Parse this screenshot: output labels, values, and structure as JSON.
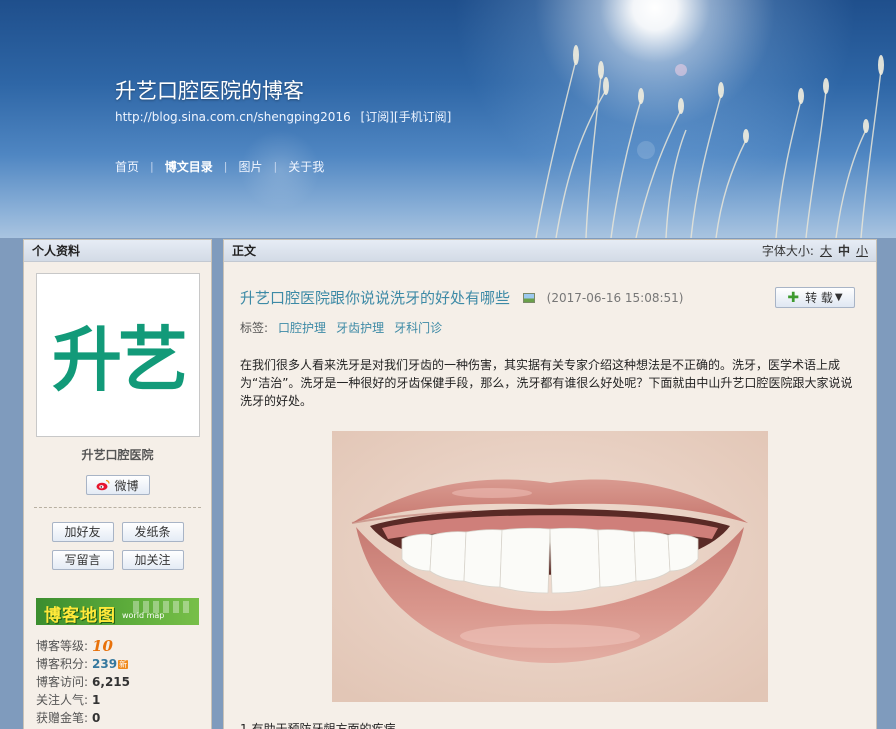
{
  "header": {
    "blog_title": "升艺口腔医院的博客",
    "blog_url": "http://blog.sina.com.cn/shengping2016",
    "subscribe": "[订阅]",
    "mobile_subscribe": "[手机订阅]",
    "nav": [
      "首页",
      "博文目录",
      "图片",
      "关于我"
    ],
    "nav_active": "博文目录"
  },
  "sidebar": {
    "title": "个人资料",
    "avatar_text": "升艺",
    "owner_name": "升艺口腔医院",
    "weibo_label": "微博",
    "buttons": [
      "加好友",
      "发纸条",
      "写留言",
      "加关注"
    ],
    "map_banner": "博客地图",
    "map_sub": "world map",
    "stats": [
      {
        "label": "博客等级:",
        "value": "10"
      },
      {
        "label": "博客积分:",
        "value": "239"
      },
      {
        "label": "博客访问:",
        "value": "6,215"
      },
      {
        "label": "关注人气:",
        "value": "1"
      },
      {
        "label": "获赠金笔:",
        "value": "0"
      }
    ],
    "new_badge": "新"
  },
  "main": {
    "section_label": "正文",
    "font_size_label": "字体大小:",
    "font_sizes": [
      "大",
      "中",
      "小"
    ],
    "font_size_current": "中",
    "post_title": "升艺口腔医院跟你说说洗牙的好处有哪些",
    "post_date": "(2017-06-16 15:08:51)",
    "repost_label": "转 载",
    "tags_label": "标签:",
    "tags": [
      "口腔护理",
      "牙齿护理",
      "牙科门诊"
    ],
    "paragraph": "在我们很多人看来洗牙是对我们牙齿的一种伤害，其实据有关专家介绍这种想法是不正确的。洗牙，医学术语上成为“洁治”。洗牙是一种很好的牙齿保健手段，那么，洗牙都有谁很么好处呢？下面就由中山升艺口腔医院跟大家说说洗牙的好处。",
    "list_line": "1.有助于预防牙龈方面的疾病"
  },
  "colors": {
    "accent_link": "#3d8aa6",
    "logo_green": "#129a79",
    "panel_bg": "#f5efe8"
  }
}
